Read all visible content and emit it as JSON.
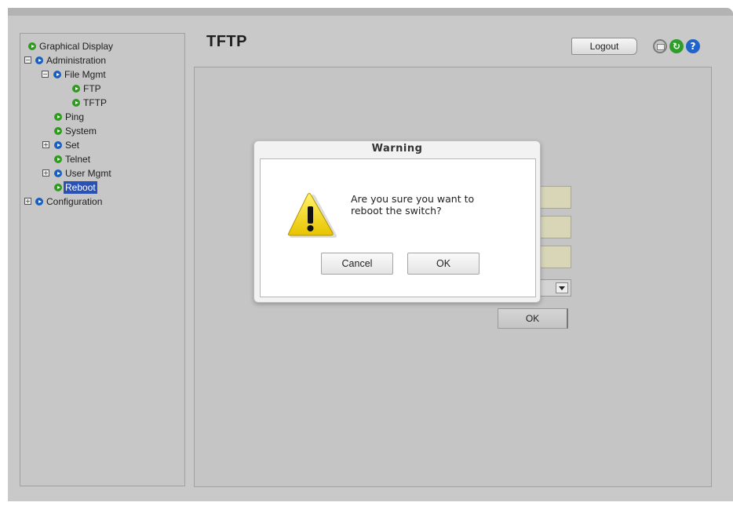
{
  "sidebar": {
    "items": [
      {
        "label": "Graphical Display"
      },
      {
        "label": "Administration",
        "toggle": "−"
      },
      {
        "label": "File Mgmt",
        "toggle": "−"
      },
      {
        "label": "FTP"
      },
      {
        "label": "TFTP"
      },
      {
        "label": "Ping"
      },
      {
        "label": "System"
      },
      {
        "label": "Set",
        "toggle": "+"
      },
      {
        "label": "Telnet"
      },
      {
        "label": "User Mgmt",
        "toggle": "+"
      },
      {
        "label": "Reboot",
        "selected": true
      },
      {
        "label": "Configuration",
        "toggle": "+"
      }
    ]
  },
  "header": {
    "title": "TFTP",
    "logout_label": "Logout",
    "refresh_glyph": "↻",
    "help_glyph": "?"
  },
  "form": {
    "ok_label": "OK"
  },
  "dialog": {
    "title": "Warning",
    "message_line1": "Are you sure you want to",
    "message_line2": "reboot the switch?",
    "cancel_label": "Cancel",
    "ok_label": "OK",
    "icon": "warning-triangle-icon"
  },
  "colors": {
    "selected_bg": "#2a52b6",
    "bullet_green": "#2e9a1e",
    "bullet_blue": "#1a5fbf",
    "field_bg": "#d8d6b7"
  }
}
